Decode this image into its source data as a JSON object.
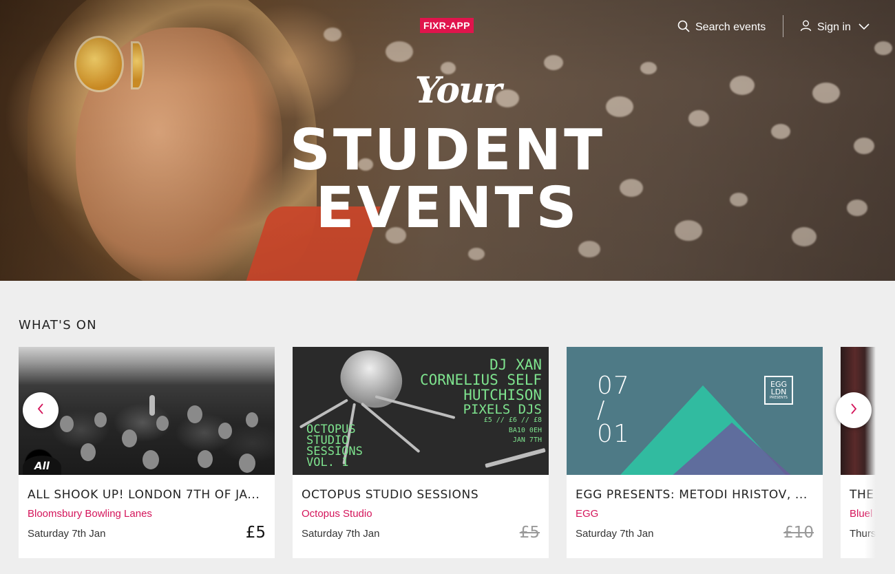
{
  "header": {
    "logo": "FIXR-APP",
    "search_label": "Search events",
    "signin_label": "Sign in",
    "brand_color": "#e0144c"
  },
  "hero": {
    "script_text": "Your",
    "line1": "STUDENT",
    "line2": "EVENTS"
  },
  "section": {
    "title": "WHAT'S ON"
  },
  "events": [
    {
      "title": "ALL SHOOK UP! LONDON 7TH OF JA...",
      "venue": "Bloomsbury Bowling Lanes",
      "date": "Saturday 7th Jan",
      "price": "£5",
      "sold_out": false,
      "image_badge": "All Shook"
    },
    {
      "title": "OCTOPUS STUDIO SESSIONS",
      "venue": "Octopus Studio",
      "date": "Saturday 7th Jan",
      "price": "£5",
      "sold_out": true,
      "poster": {
        "lines_right": [
          "DJ XAN",
          "CORNELIUS SELF",
          "HUTCHISON",
          "PIXELS DJS"
        ],
        "details": [
          "£5 // £6 // £8",
          "BA10 0EH",
          "JAN 7TH"
        ],
        "lines_left": [
          "OCTOPUS",
          "STUDIO",
          "SESSIONS",
          "VOL. 1"
        ]
      }
    },
    {
      "title": "EGG PRESENTS: METODI HRISTOV, ...",
      "venue": "EGG",
      "date": "Saturday 7th Jan",
      "price": "£10",
      "sold_out": true,
      "poster": {
        "day": "07",
        "slash": "/",
        "month": "01",
        "logo_top": "EGG",
        "logo_bottom": "LDN",
        "logo_sub": "PRESENTS"
      }
    },
    {
      "title": "THE",
      "venue": "Bluel",
      "date": "Thurs"
    }
  ],
  "icons": {
    "search": "search-icon",
    "user": "user-icon",
    "chevron": "chevron-down-icon",
    "prev": "chevron-left-icon",
    "next": "chevron-right-icon"
  },
  "colors": {
    "accent": "#d4145a",
    "sold_out_price": "#999999"
  }
}
